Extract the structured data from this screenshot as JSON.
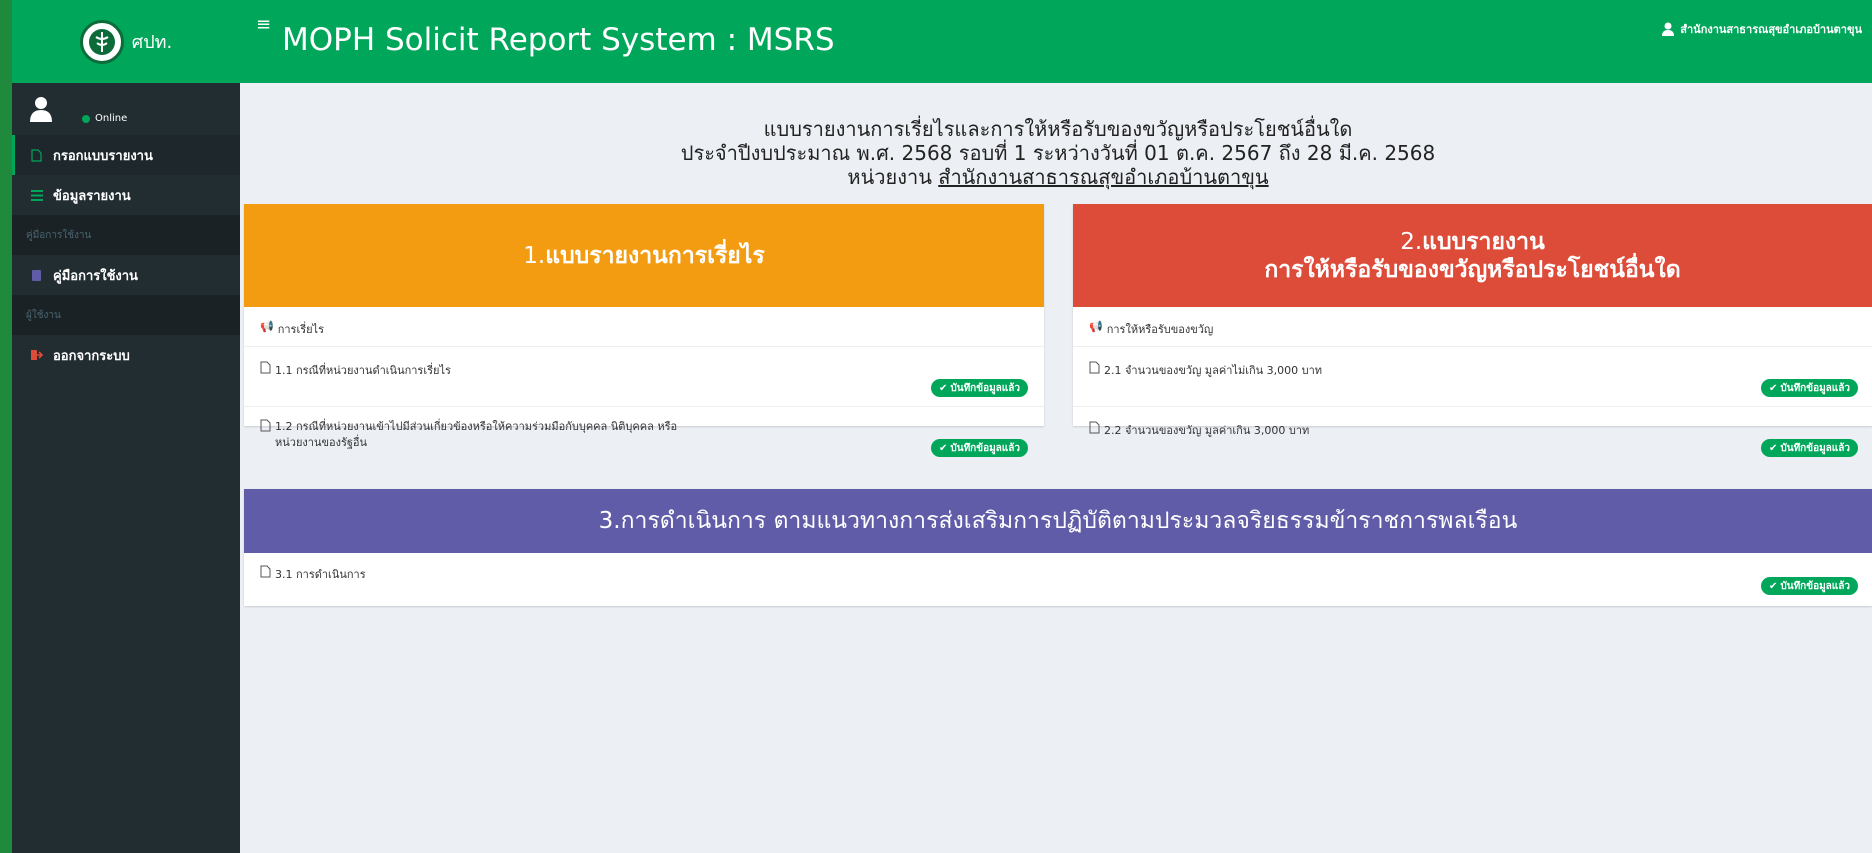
{
  "sidebar": {
    "logo_text": "ศปท.",
    "online_label": "Online",
    "menu": [
      {
        "label": "กรอกแบบรายงาน"
      },
      {
        "label": "ข้อมูลรายงาน"
      },
      {
        "header": "คู่มือการใช้งาน"
      },
      {
        "label": "คู่มือการใช้งาน"
      },
      {
        "header": "ผู้ใช้งาน"
      },
      {
        "label": "ออกจากระบบ"
      }
    ]
  },
  "header": {
    "menu_icon": "≡",
    "title": "MOPH Solicit Report System : MSRS",
    "user_name": "สำนักงานสาธารณสุขอำเภอบ้านตาขุน"
  },
  "report": {
    "title_line1": "แบบรายงานการเรี่ยไรและการให้หรือรับของขวัญหรือประโยชน์อื่นใด",
    "title_line2": "ประจำปีงบประมาณ พ.ศ. 2568 รอบที่ 1 ระหว่างวันที่ 01 ต.ค. 2567 ถึง 28 มี.ค. 2568",
    "unit_prefix": "หน่วยงาน",
    "unit_name": "สำนักงานสาธารณสุขอำเภอบ้านตาขุน"
  },
  "panels": {
    "p1": {
      "number": "1.",
      "title": "แบบรายงานการเรี่ยไร",
      "color": "#f39c12",
      "section": "การเรี่ยไร",
      "items": [
        {
          "label": "1.1 กรณีที่หน่วยงานดำเนินการเรี่ยไร",
          "status": "บันทึกข้อมูลแล้ว"
        },
        {
          "label": "1.2 กรณีที่หน่วยงานเข้าไปมีส่วนเกี่ยวข้องหรือให้ความร่วมมือกับบุคคล นิติบุคคล หรือหน่วยงานของรัฐอื่น",
          "status": "บันทึกข้อมูลแล้ว"
        }
      ]
    },
    "p2": {
      "number": "2.",
      "title_line1": "แบบรายงาน",
      "title_line2": "การให้หรือรับของขวัญหรือประโยชน์อื่นใด",
      "color": "#dd4b39",
      "section": "การให้หรือรับของขวัญ",
      "items": [
        {
          "label": "2.1 จำนวนของขวัญ มูลค่าไม่เกิน 3,000 บาท",
          "status": "บันทึกข้อมูลแล้ว"
        },
        {
          "label": "2.2 จำนวนของขวัญ มูลค่าเกิน 3,000 บาท",
          "status": "บันทึกข้อมูลแล้ว"
        }
      ]
    },
    "p3": {
      "number": "3.",
      "title": "การดำเนินการ ตามแนวทางการส่งเสริมการปฏิบัติตามประมวลจริยธรรมข้าราชการพลเรือน",
      "color": "#605ca8",
      "items": [
        {
          "label": "3.1 การดำเนินการ",
          "status": "บันทึกข้อมูลแล้ว"
        }
      ]
    }
  },
  "colors": {
    "header": "#00a65a",
    "sidebar": "#222d32",
    "badge": "#00a65a"
  },
  "icons": {
    "check": "✔",
    "megaphone": "megaphone-icon",
    "doc": "file-icon"
  }
}
